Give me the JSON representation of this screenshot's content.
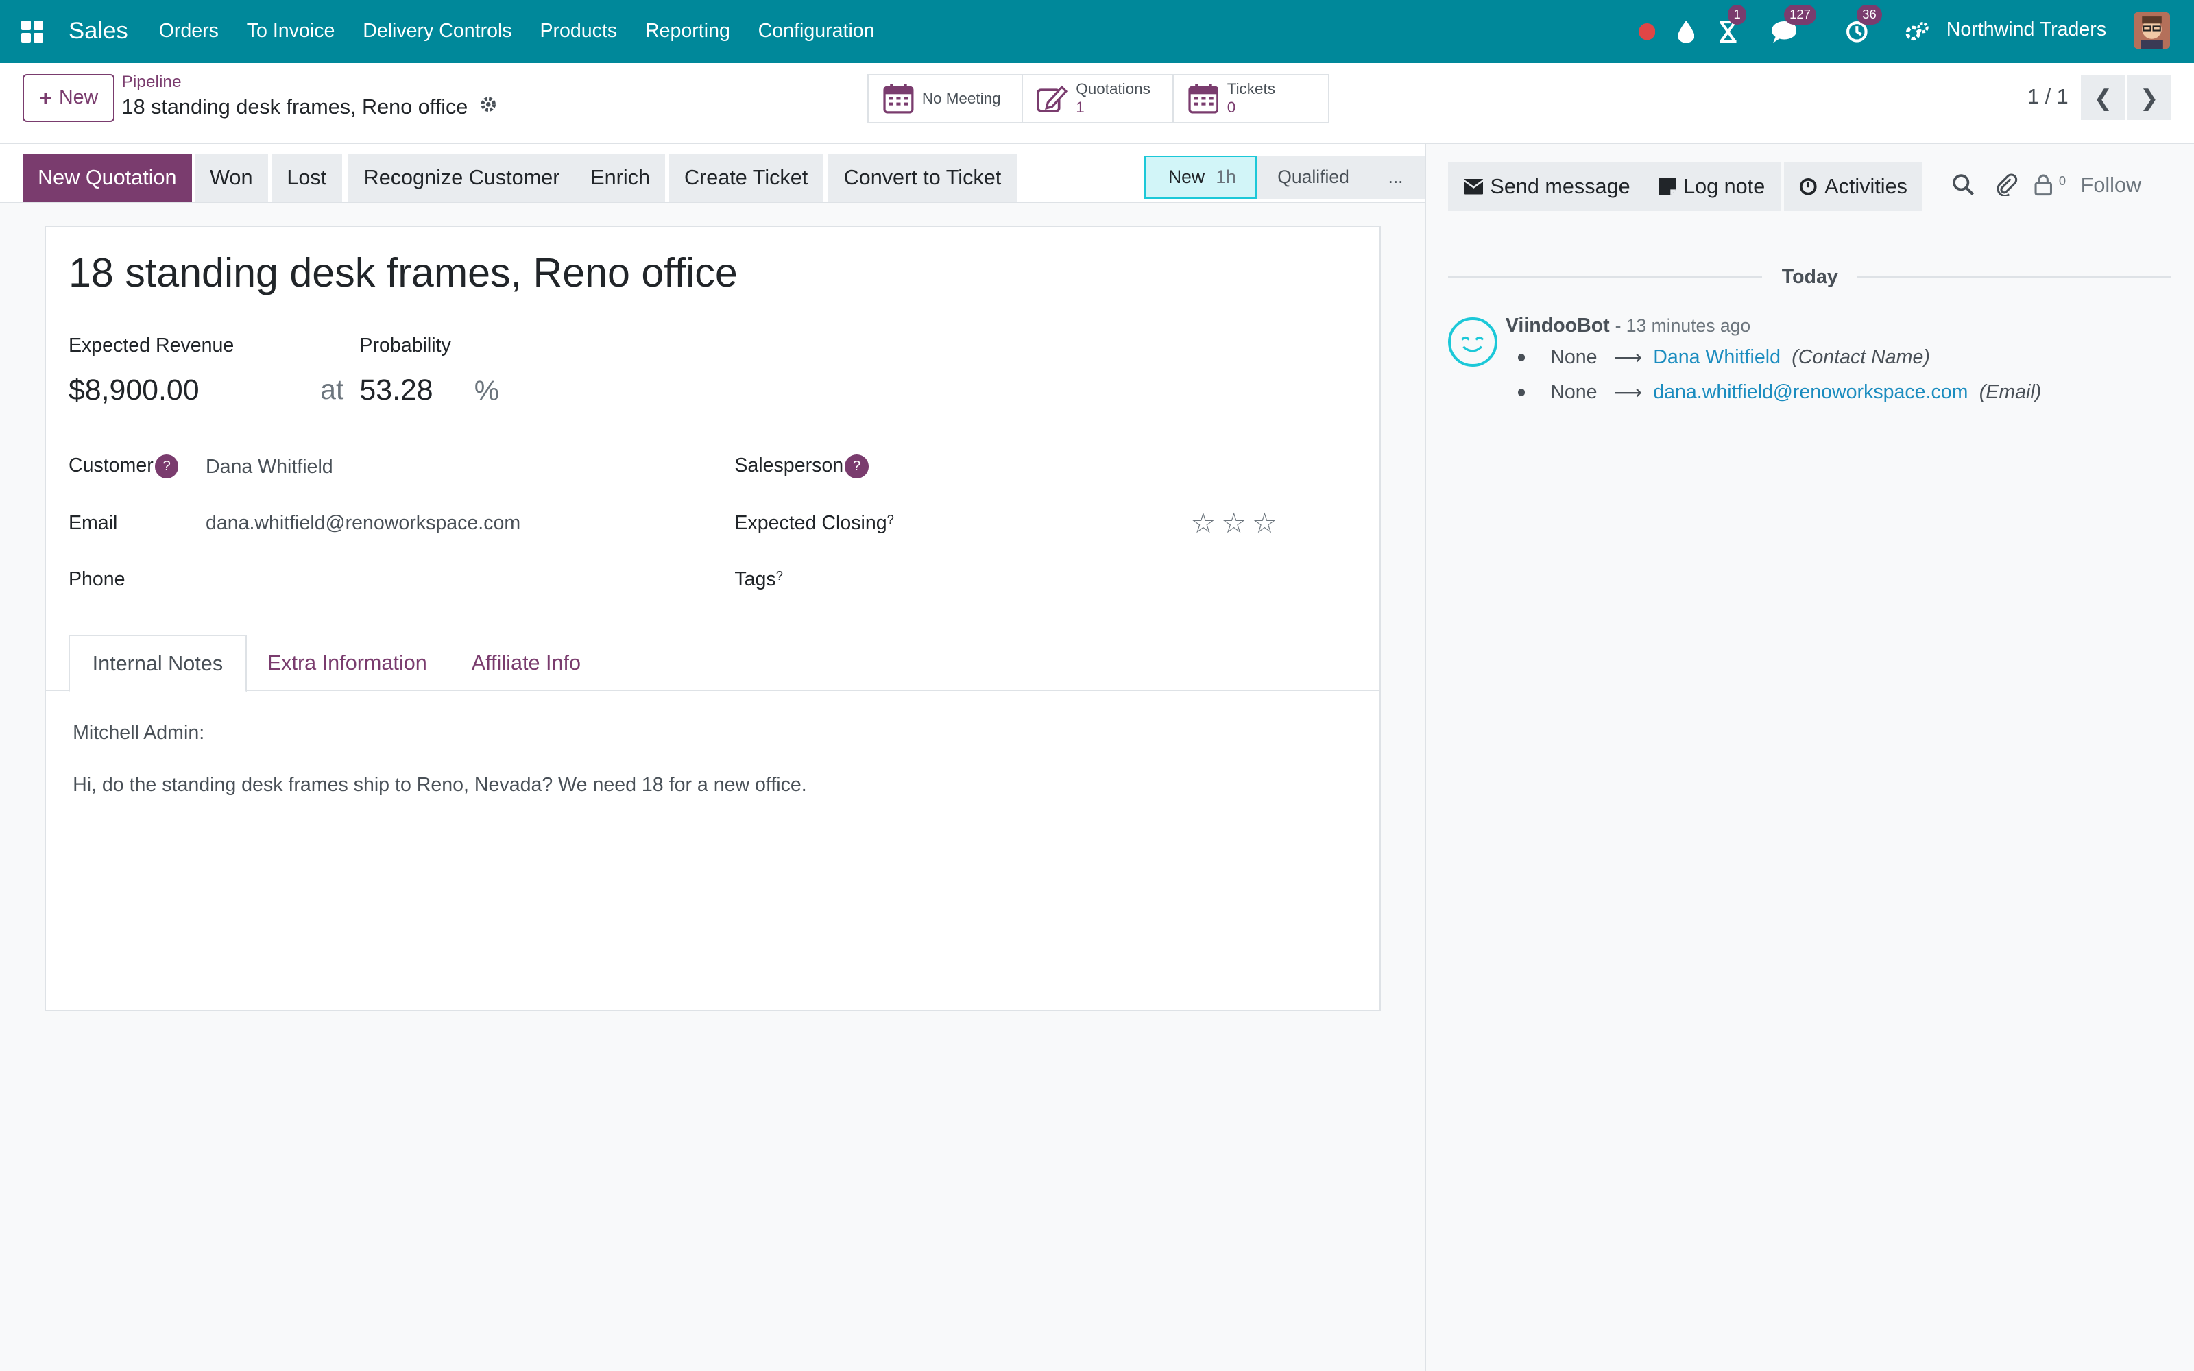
{
  "topbar": {
    "app_name": "Sales",
    "menu": [
      "Orders",
      "To Invoice",
      "Delivery Controls",
      "Products",
      "Reporting",
      "Configuration"
    ],
    "activity_badge": "1",
    "messages_badge": "127",
    "timer_badge": "36",
    "company": "Northwind Traders",
    "icons": [
      "apps-grid-icon",
      "record-dot-icon",
      "drop-icon",
      "hourglass-icon",
      "chat-icon",
      "clock-icon",
      "settings-icon"
    ]
  },
  "control": {
    "new_label": "New",
    "breadcrumb": "Pipeline",
    "record_title": "18 standing desk frames, Reno office",
    "smart_buttons": [
      {
        "label": "No Meeting",
        "count": ""
      },
      {
        "label": "Quotations",
        "count": "1"
      },
      {
        "label": "Tickets",
        "count": "0"
      }
    ],
    "pager": "1 / 1"
  },
  "statusbar": {
    "actions": [
      "New Quotation",
      "Won",
      "Lost",
      "Recognize Customer",
      "Enrich",
      "Create Ticket",
      "Convert to Ticket"
    ],
    "stage_current": "New",
    "stage_duration": "1h",
    "stage_next": "Qualified",
    "stage_more": "..."
  },
  "form": {
    "lead_name": "18 standing desk frames, Reno office",
    "expected_revenue_label": "Expected Revenue",
    "expected_revenue": "$8,900.00",
    "at": "at",
    "probability_label": "Probability",
    "probability": "53.28",
    "percent": "%",
    "customer_label": "Customer",
    "customer": "Dana Whitfield",
    "email_label": "Email",
    "email": "dana.whitfield@renoworkspace.com",
    "phone_label": "Phone",
    "phone": "",
    "salesperson_label": "Salesperson",
    "expected_closing_label": "Expected Closing",
    "tags_label": "Tags",
    "priority_stars": 0,
    "help_mark": "?",
    "tabs": [
      "Internal Notes",
      "Extra Information",
      "Affiliate Info"
    ],
    "note_author": "Mitchell Admin:",
    "note_text": "Hi, do the standing desk frames ship to Reno, Nevada? We need 18 for a new office."
  },
  "chatter": {
    "send_message": "Send message",
    "log_note": "Log note",
    "activities": "Activities",
    "followers_count": "0",
    "follow": "Follow",
    "day_separator": "Today",
    "message": {
      "author": "ViindooBot",
      "time": "- 13 minutes ago",
      "changes": [
        {
          "old": "None",
          "new": "Dana Whitfield",
          "field": "(Contact Name)"
        },
        {
          "old": "None",
          "new": "dana.whitfield@renoworkspace.com",
          "field": "(Email)"
        }
      ]
    }
  },
  "colors": {
    "navbar": "#00889a",
    "primary": "#7a3c6e",
    "stage_active": "#d2f5f8",
    "link": "#1a8cbf"
  }
}
